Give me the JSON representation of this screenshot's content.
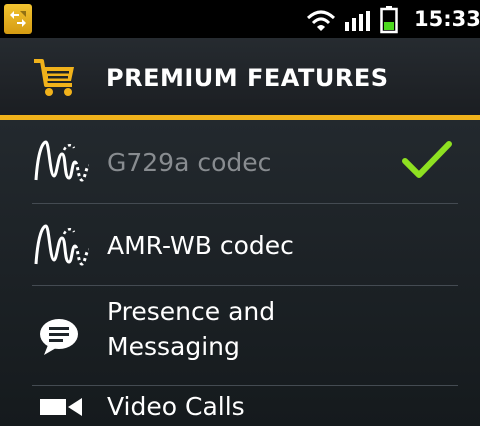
{
  "status_bar": {
    "time": "15:33",
    "icons": [
      "app-notification-icon",
      "wifi-icon",
      "signal-icon",
      "battery-icon"
    ],
    "battery_color": "#4cd81e"
  },
  "header": {
    "title": "PREMIUM FEATURES",
    "icon": "shopping-cart-icon",
    "accent_color": "#f1b21b"
  },
  "features": [
    {
      "label": "G729a codec",
      "icon": "waveform-icon",
      "enabled": false,
      "selected": true
    },
    {
      "label": "AMR-WB codec",
      "icon": "waveform-icon",
      "enabled": true,
      "selected": false
    },
    {
      "label_line1": "Presence and",
      "label_line2": "Messaging",
      "icon": "chat-bubble-icon",
      "enabled": true,
      "selected": false
    },
    {
      "label": "Video Calls",
      "icon": "video-camera-icon",
      "enabled": true,
      "selected": false
    }
  ],
  "check_color": "#8ee021"
}
